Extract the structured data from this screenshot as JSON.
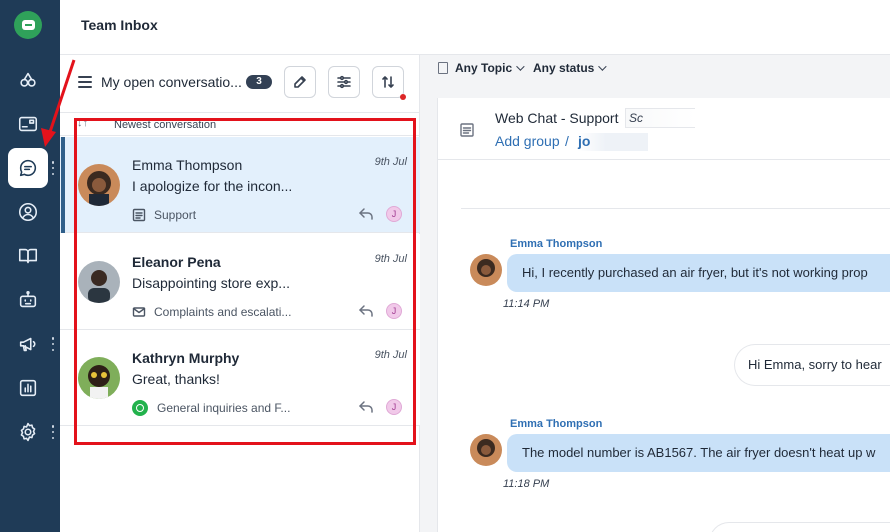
{
  "header": {
    "title": "Team Inbox"
  },
  "nav": [
    {
      "name": "integrations-icon"
    },
    {
      "name": "reports-inbox-icon"
    },
    {
      "name": "conversations-icon",
      "active": true
    },
    {
      "name": "contacts-icon"
    },
    {
      "name": "knowledge-base-icon"
    },
    {
      "name": "bot-icon"
    },
    {
      "name": "campaigns-icon"
    },
    {
      "name": "analytics-icon"
    },
    {
      "name": "settings-icon"
    }
  ],
  "list": {
    "title": "My open conversatio...",
    "count": "3",
    "sort_label": "Newest conversation",
    "sort_icon": "↓↑"
  },
  "conversations": [
    {
      "name": "Emma Thompson",
      "date": "9th Jul",
      "preview": "I apologize for the incon...",
      "tag": "Support",
      "channel": "web-chat-icon",
      "assignee": "J"
    },
    {
      "name": "Eleanor Pena",
      "date": "9th Jul",
      "preview": "Disappointing store exp...",
      "tag": "Complaints and escalati...",
      "channel": "email-icon",
      "assignee": "J"
    },
    {
      "name": "Kathryn Murphy",
      "date": "9th Jul",
      "preview": "Great, thanks!",
      "tag": "General inquiries and F...",
      "channel": "whatsapp-icon",
      "assignee": "J"
    }
  ],
  "filters": {
    "topic": "Any Topic",
    "status": "Any status"
  },
  "chat": {
    "title": "Web Chat - Support",
    "badge": "Sc",
    "group_link": "Add group",
    "separator": "/",
    "user": "jo",
    "messages": [
      {
        "author": "Emma Thompson",
        "text": "Hi, I recently purchased an air fryer, but it's not working prop",
        "time": "11:14 PM"
      },
      {
        "author": "agent",
        "text": "Hi Emma, sorry to hear"
      },
      {
        "author": "Emma Thompson",
        "text": "The model number is AB1567. The air fryer doesn't heat up w",
        "time": "11:18 PM"
      }
    ]
  },
  "colors": {
    "rail": "#1f3b57",
    "accent": "#2f6fb3",
    "selected_row": "#e3f0fc",
    "highlight": "#e3121b",
    "incoming_bubble": "#c9e1f8"
  }
}
